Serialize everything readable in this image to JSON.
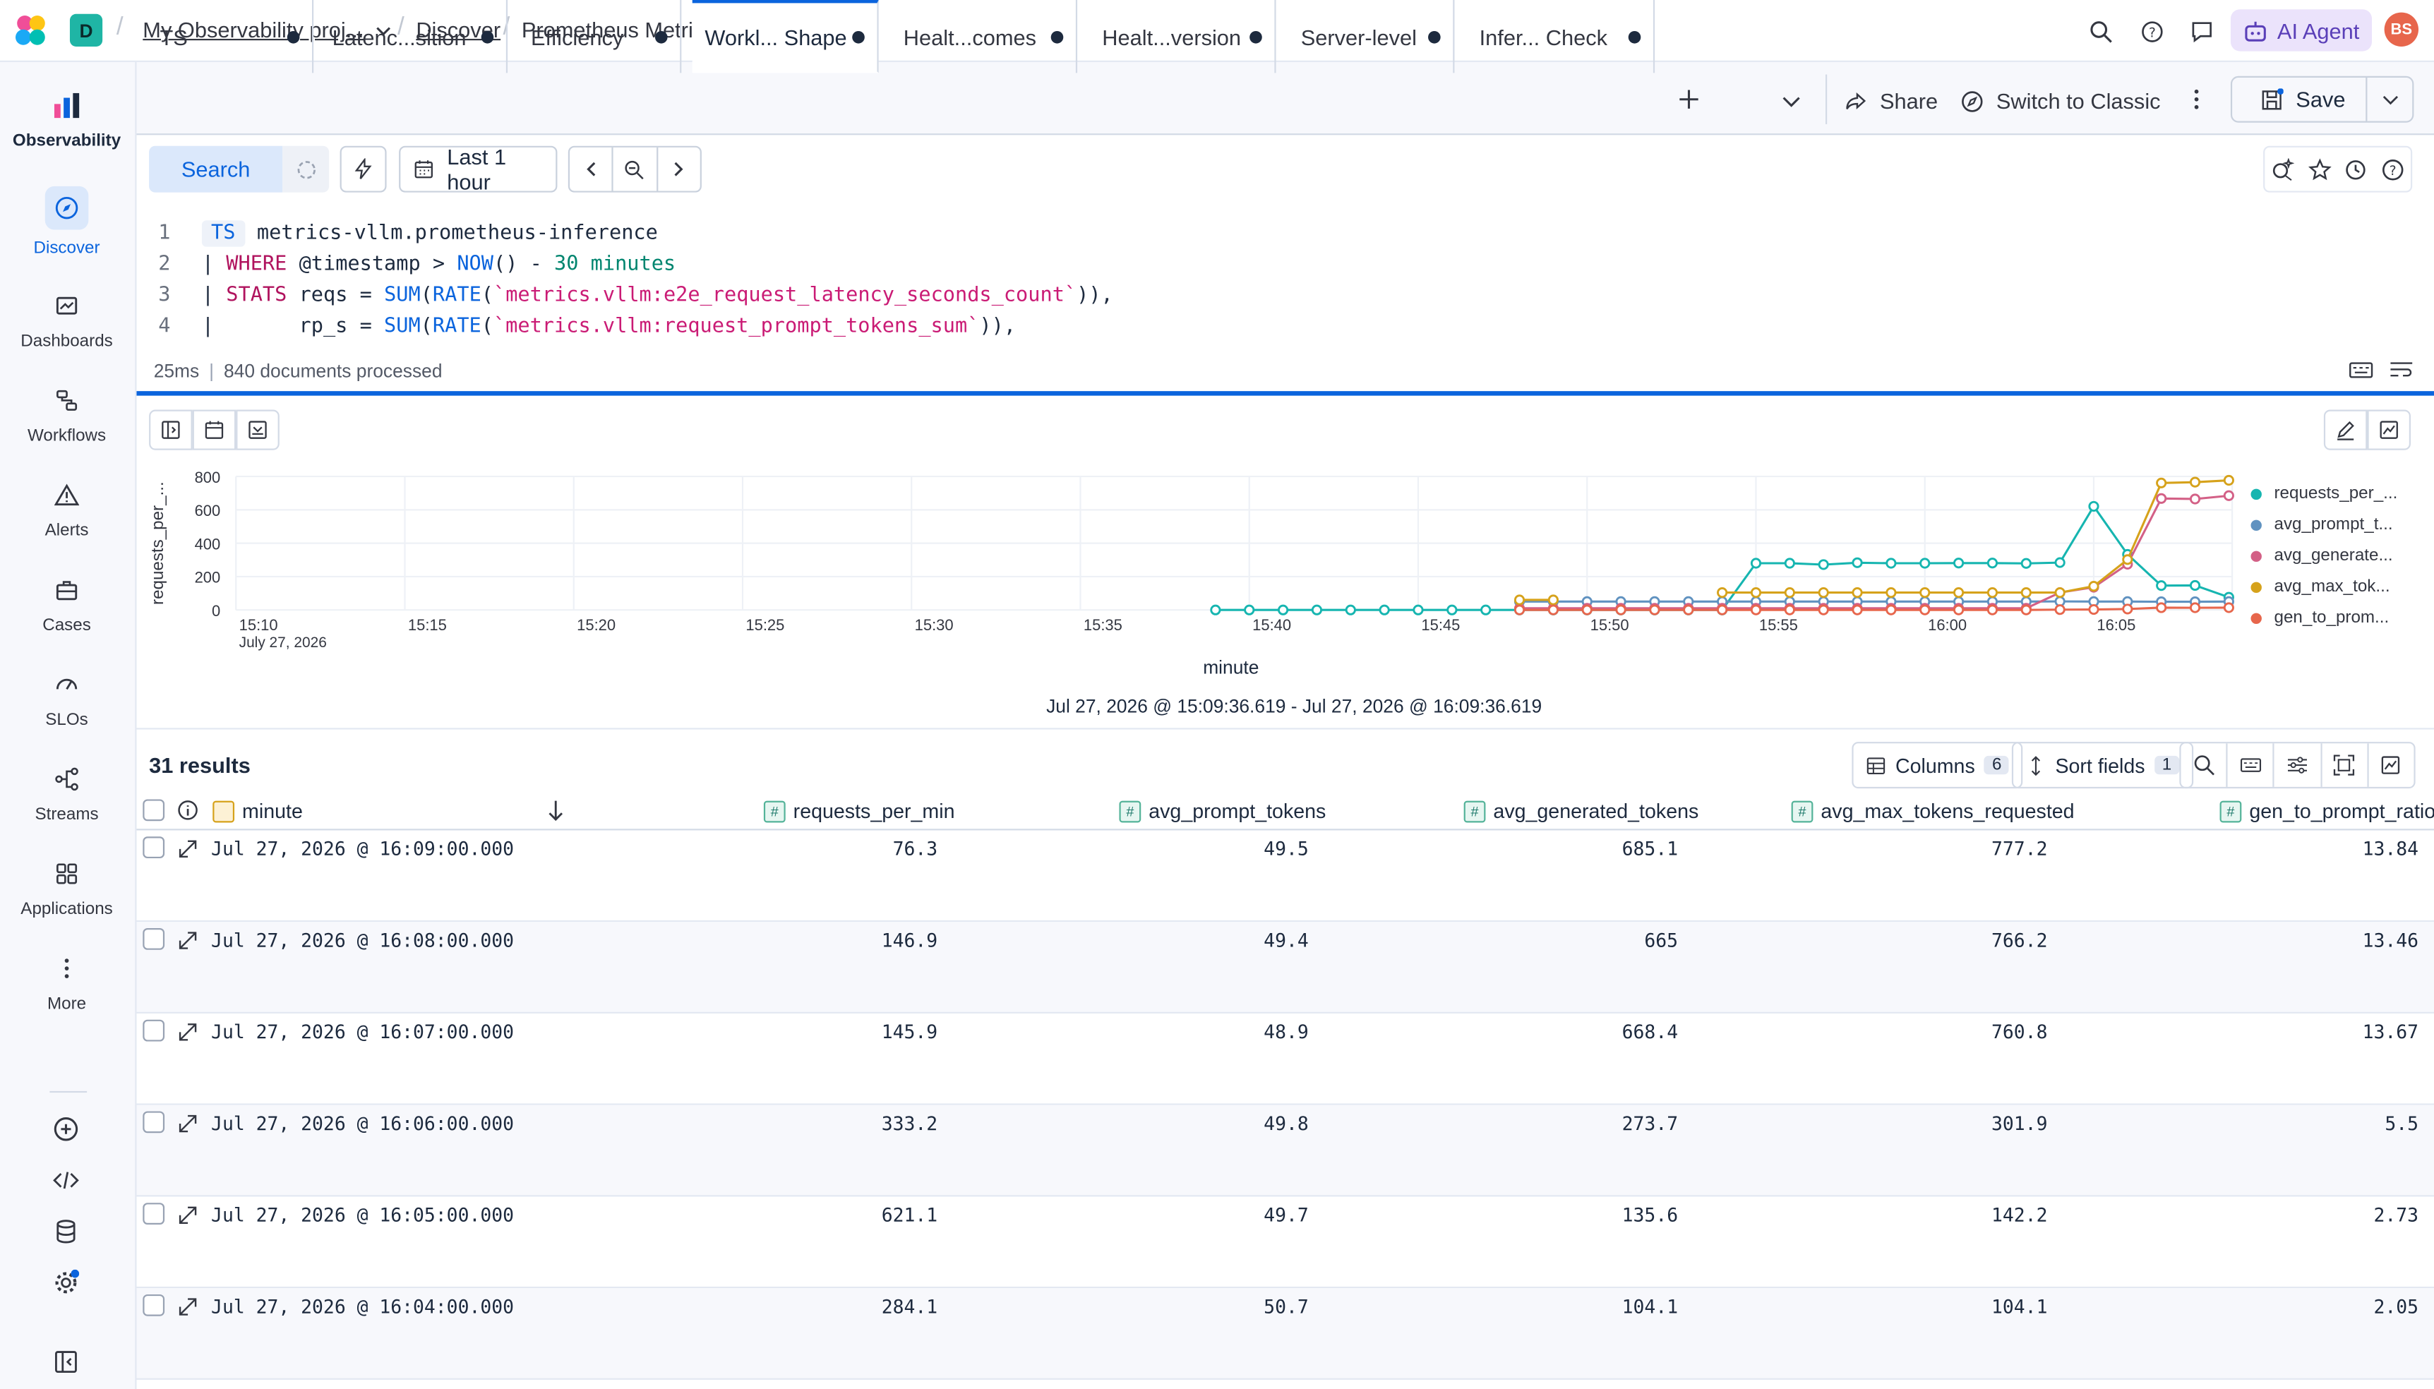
{
  "header": {
    "space_initial": "D",
    "project": "My Observability proj...",
    "discover": "Discover",
    "title": "Prometheus Metrics - ESQL",
    "ai_agent": "AI Agent",
    "avatar": "BS"
  },
  "sidebar": {
    "items": [
      {
        "label": "Observability",
        "icon": "observability-logo-icon"
      },
      {
        "label": "Discover",
        "icon": "compass-icon"
      },
      {
        "label": "Dashboards",
        "icon": "dashboard-icon"
      },
      {
        "label": "Workflows",
        "icon": "workflow-icon"
      },
      {
        "label": "Alerts",
        "icon": "alert-icon"
      },
      {
        "label": "Cases",
        "icon": "briefcase-icon"
      },
      {
        "label": "SLOs",
        "icon": "gauge-icon"
      },
      {
        "label": "Streams",
        "icon": "streams-icon"
      },
      {
        "label": "Applications",
        "icon": "grid-icon"
      },
      {
        "label": "More",
        "icon": "more-icon"
      }
    ]
  },
  "tabs": [
    {
      "label": "TS"
    },
    {
      "label": "Latenc...sition"
    },
    {
      "label": "Efficiency"
    },
    {
      "label": "Workl... Shape"
    },
    {
      "label": "Healt...comes"
    },
    {
      "label": "Healt...version"
    },
    {
      "label": "Server-level"
    },
    {
      "label": "Infer... Check"
    }
  ],
  "toolbar": {
    "share": "Share",
    "switch_classic": "Switch to Classic",
    "save": "Save"
  },
  "query": {
    "search": "Search",
    "time_range": "Last 1 hour",
    "lines": [
      "1",
      "2",
      "3",
      "4"
    ],
    "status_time": "25ms",
    "status_docs": "840 documents processed"
  },
  "chart": {
    "xlabel": "minute",
    "range_label": "Jul 27, 2026 @ 15:09:36.619 - Jul 27, 2026 @ 16:09:36.619"
  },
  "chart_data": {
    "type": "line",
    "ylabel": "requests_per_...",
    "xlabel": "minute",
    "ylim": [
      0,
      800
    ],
    "yticks": [
      0,
      200,
      400,
      600,
      800
    ],
    "xticks": [
      "15:10",
      "15:15",
      "15:20",
      "15:25",
      "15:30",
      "15:35",
      "15:40",
      "15:45",
      "15:50",
      "15:55",
      "16:00",
      "16:05"
    ],
    "x_start_label": "July 27, 2026",
    "x": [
      "15:39",
      "15:40",
      "15:41",
      "15:42",
      "15:43",
      "15:44",
      "15:45",
      "15:46",
      "15:47",
      "15:48",
      "15:49",
      "15:50",
      "15:51",
      "15:52",
      "15:53",
      "15:54",
      "15:55",
      "15:56",
      "15:57",
      "15:58",
      "15:59",
      "16:00",
      "16:01",
      "16:02",
      "16:03",
      "16:04",
      "16:05",
      "16:06",
      "16:07",
      "16:08",
      "16:09"
    ],
    "series": [
      {
        "name": "requests_per_...",
        "color": "#16b5b0",
        "values": [
          0,
          0,
          0,
          0,
          0,
          0,
          0,
          0,
          0,
          0,
          0,
          0,
          0,
          0,
          0,
          0,
          280,
          280,
          272,
          283,
          280,
          280,
          281,
          281,
          279,
          284,
          621,
          333,
          146,
          147,
          76
        ]
      },
      {
        "name": "avg_prompt_t...",
        "color": "#6092c0",
        "values": [
          null,
          null,
          null,
          null,
          null,
          null,
          null,
          null,
          null,
          50,
          50,
          50,
          50,
          50,
          50,
          50,
          50,
          50,
          50,
          50,
          50,
          50,
          50,
          50,
          50,
          51,
          50,
          50,
          49,
          49,
          50
        ]
      },
      {
        "name": "avg_generate...",
        "color": "#d36086",
        "values": [
          null,
          null,
          null,
          null,
          null,
          null,
          null,
          null,
          null,
          10,
          10,
          10,
          10,
          10,
          10,
          10,
          10,
          10,
          10,
          10,
          10,
          10,
          10,
          10,
          10,
          104,
          136,
          274,
          668,
          665,
          685
        ]
      },
      {
        "name": "avg_max_tok...",
        "color": "#d6a21b",
        "values": [
          null,
          null,
          null,
          null,
          null,
          null,
          null,
          null,
          null,
          60,
          60,
          null,
          null,
          null,
          null,
          104,
          104,
          104,
          104,
          104,
          104,
          104,
          104,
          104,
          104,
          104,
          142,
          302,
          761,
          766,
          777
        ]
      },
      {
        "name": "gen_to_prom...",
        "color": "#e7664c",
        "values": [
          null,
          null,
          null,
          null,
          null,
          null,
          null,
          null,
          null,
          0.2,
          0.2,
          0.2,
          0.2,
          0.2,
          0.2,
          0.2,
          0.2,
          0.2,
          0.2,
          0.2,
          0.2,
          0.2,
          0.2,
          0.2,
          0.2,
          2.05,
          2.73,
          5.5,
          13.67,
          13.46,
          13.84
        ]
      }
    ]
  },
  "results": {
    "count": "31 results",
    "columns_label": "Columns",
    "columns_count": "6",
    "sort_label": "Sort fields",
    "sort_count": "1"
  },
  "table": {
    "headers": [
      "minute",
      "requests_per_min",
      "avg_prompt_tokens",
      "avg_generated_tokens",
      "avg_max_tokens_requested",
      "gen_to_prompt_ratio"
    ],
    "rows": [
      [
        "Jul 27, 2026 @ 16:09:00.000",
        "76.3",
        "49.5",
        "685.1",
        "777.2",
        "13.84"
      ],
      [
        "Jul 27, 2026 @ 16:08:00.000",
        "146.9",
        "49.4",
        "665",
        "766.2",
        "13.46"
      ],
      [
        "Jul 27, 2026 @ 16:07:00.000",
        "145.9",
        "48.9",
        "668.4",
        "760.8",
        "13.67"
      ],
      [
        "Jul 27, 2026 @ 16:06:00.000",
        "333.2",
        "49.8",
        "273.7",
        "301.9",
        "5.5"
      ],
      [
        "Jul 27, 2026 @ 16:05:00.000",
        "621.1",
        "49.7",
        "135.6",
        "142.2",
        "2.73"
      ],
      [
        "Jul 27, 2026 @ 16:04:00.000",
        "284.1",
        "50.7",
        "104.1",
        "104.1",
        "2.05"
      ]
    ]
  }
}
